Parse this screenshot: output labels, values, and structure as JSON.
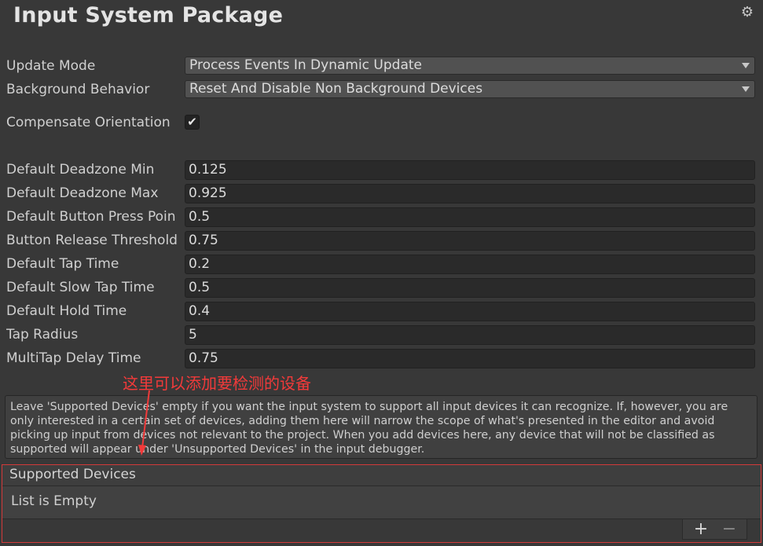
{
  "header": {
    "title": "Input System Package",
    "settings_icon": "gear-icon"
  },
  "settings": {
    "update_mode": {
      "label": "Update Mode",
      "value": "Process Events In Dynamic Update"
    },
    "background_behavior": {
      "label": "Background Behavior",
      "value": "Reset And Disable Non Background Devices"
    },
    "compensate_orientation": {
      "label": "Compensate Orientation",
      "checked": true,
      "check_glyph": "✔"
    }
  },
  "fields": [
    {
      "label": "Default Deadzone Min",
      "value": "0.125"
    },
    {
      "label": "Default Deadzone Max",
      "value": "0.925"
    },
    {
      "label": "Default Button Press Poin",
      "value": "0.5"
    },
    {
      "label": "Button Release Threshold",
      "value": "0.75"
    },
    {
      "label": "Default Tap Time",
      "value": "0.2"
    },
    {
      "label": "Default Slow Tap Time",
      "value": "0.5"
    },
    {
      "label": "Default Hold Time",
      "value": "0.4"
    },
    {
      "label": "Tap Radius",
      "value": "5"
    },
    {
      "label": "MultiTap Delay Time",
      "value": "0.75"
    }
  ],
  "annotation": {
    "text": "这里可以添加要检测的设备",
    "color": "#f23a3a"
  },
  "help_text": "Leave 'Supported Devices' empty if you want the input system to support all input devices it can recognize. If, however, you are only interested in a certain set of devices, adding them here will narrow the scope of what's presented in the editor and avoid picking up input from devices not relevant to the project. When you add devices here, any device that will not be classified as supported will appear under 'Unsupported Devices' in the input debugger.",
  "supported_devices": {
    "header": "Supported Devices",
    "empty_text": "List is Empty",
    "add_label": "+",
    "remove_label": "−"
  }
}
